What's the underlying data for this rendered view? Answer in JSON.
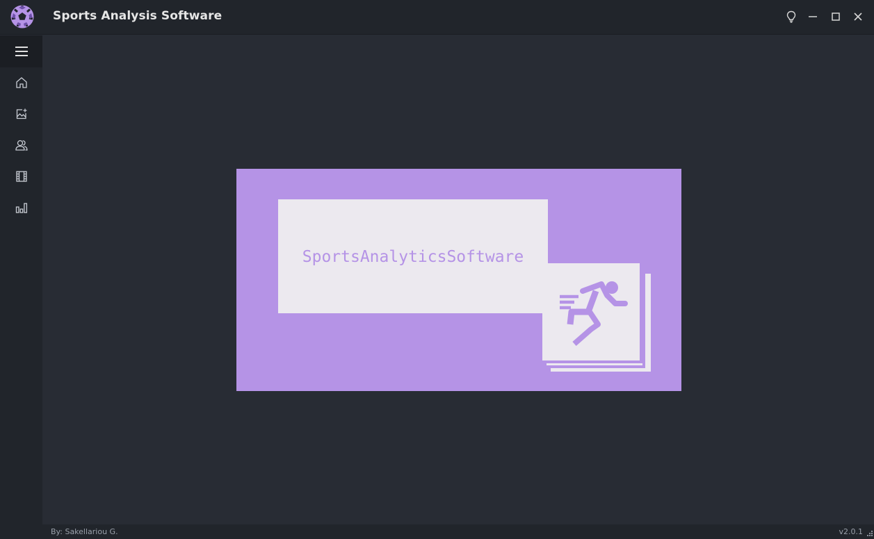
{
  "app": {
    "title": "Sports Analysis Software",
    "logo_icon": "soccer-ball-icon"
  },
  "window_controls": [
    {
      "icon": "lightbulb-icon"
    },
    {
      "icon": "minimize-icon"
    },
    {
      "icon": "maximize-icon"
    },
    {
      "icon": "close-icon"
    }
  ],
  "sidebar": {
    "toggle_icon": "hamburger-menu-icon",
    "items": [
      {
        "icon": "home-icon"
      },
      {
        "icon": "image-add-icon"
      },
      {
        "icon": "users-icon"
      },
      {
        "icon": "film-icon"
      },
      {
        "icon": "bar-chart-icon"
      }
    ]
  },
  "banner": {
    "text": "SportsAnalyticsSoftware",
    "icon": "running-person-icon",
    "colors": {
      "accent": "#b593e6",
      "card": "#ece9ef"
    }
  },
  "footer": {
    "credit": "By: Sakellariou G.",
    "version": "v2.0.1"
  },
  "theme": {
    "background": "#282c34",
    "panel": "#21252b",
    "accent": "#b593e6"
  }
}
